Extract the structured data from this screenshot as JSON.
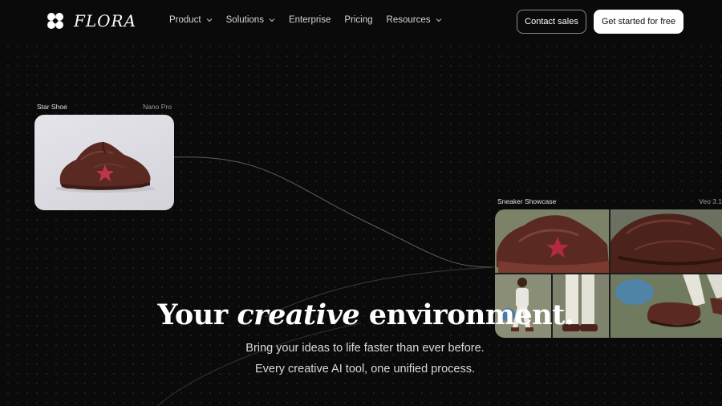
{
  "nav": {
    "logo_text": "FLORA",
    "menu": [
      {
        "label": "Product",
        "has_dropdown": true
      },
      {
        "label": "Solutions",
        "has_dropdown": true
      },
      {
        "label": "Enterprise",
        "has_dropdown": false
      },
      {
        "label": "Pricing",
        "has_dropdown": false
      },
      {
        "label": "Resources",
        "has_dropdown": true
      }
    ],
    "contact_label": "Contact sales",
    "cta_label": "Get started for free"
  },
  "cards": [
    {
      "title": "Star Shoe",
      "model": "Nano Pro"
    },
    {
      "title": "Sneaker Showcase",
      "model": "Veo 3.1"
    }
  ],
  "hero": {
    "title_start": "Your ",
    "title_emphasis": "creative",
    "title_end": " environment.",
    "subtitle_line1": "Bring your ideas to life faster than ever before.",
    "subtitle_line2": "Every creative AI tool, one unified process."
  },
  "colors": {
    "background": "#0a0a0a",
    "shoe_brown": "#5a2a22",
    "star_red": "#c0344a",
    "olive": "#7a8068"
  },
  "icons": [
    "flora-logo-icon",
    "chevron-down-icon"
  ]
}
